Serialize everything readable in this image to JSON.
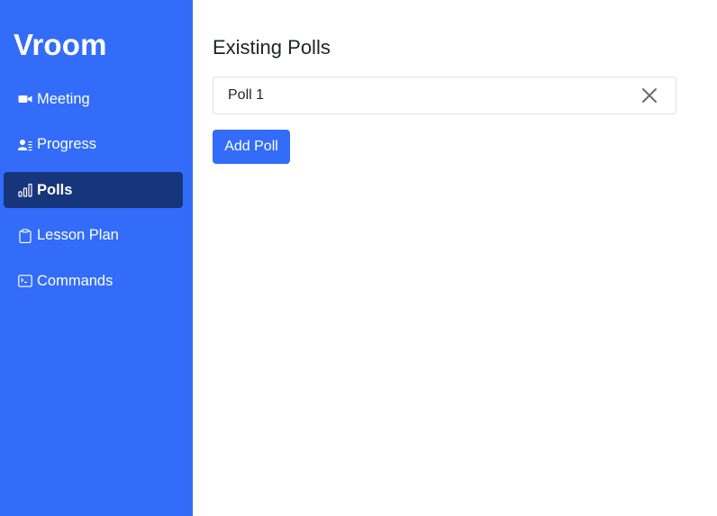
{
  "sidebar": {
    "brand": "Vroom",
    "items": [
      {
        "label": "Meeting",
        "icon": "video-camera-icon",
        "active": false
      },
      {
        "label": "Progress",
        "icon": "person-lines-icon",
        "active": false
      },
      {
        "label": "Polls",
        "icon": "bar-chart-icon",
        "active": true
      },
      {
        "label": "Lesson Plan",
        "icon": "clipboard-icon",
        "active": false
      },
      {
        "label": "Commands",
        "icon": "terminal-icon",
        "active": false
      }
    ]
  },
  "main": {
    "title": "Existing Polls",
    "polls": [
      {
        "name": "Poll 1"
      }
    ],
    "add_button_label": "Add Poll"
  },
  "colors": {
    "sidebar_bg": "#326cf9",
    "active_item_bg": "#17357b",
    "button_bg": "#326cf9"
  }
}
